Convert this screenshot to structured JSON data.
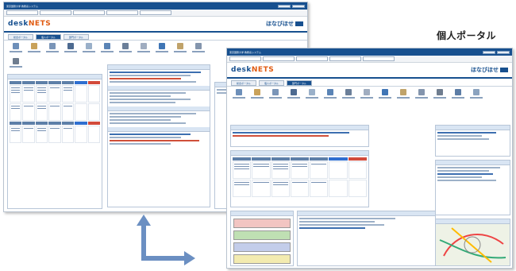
{
  "caption": "個人ポータル",
  "back_window": {
    "title": "東京国際大学 教務系システム",
    "logo_a": "desk",
    "logo_b": "NETS",
    "brand": "ほなびほせ",
    "tabs": [
      "総合ポータル",
      "個人ポータル",
      "部門ポータル"
    ]
  },
  "front_window": {
    "title": "東京国際大学 教務系システム",
    "logo_a": "desk",
    "logo_b": "NETS",
    "brand": "ほなびほせ",
    "tabs": [
      "総合ポータル",
      "個人ポータル",
      "部門ポータル"
    ]
  }
}
